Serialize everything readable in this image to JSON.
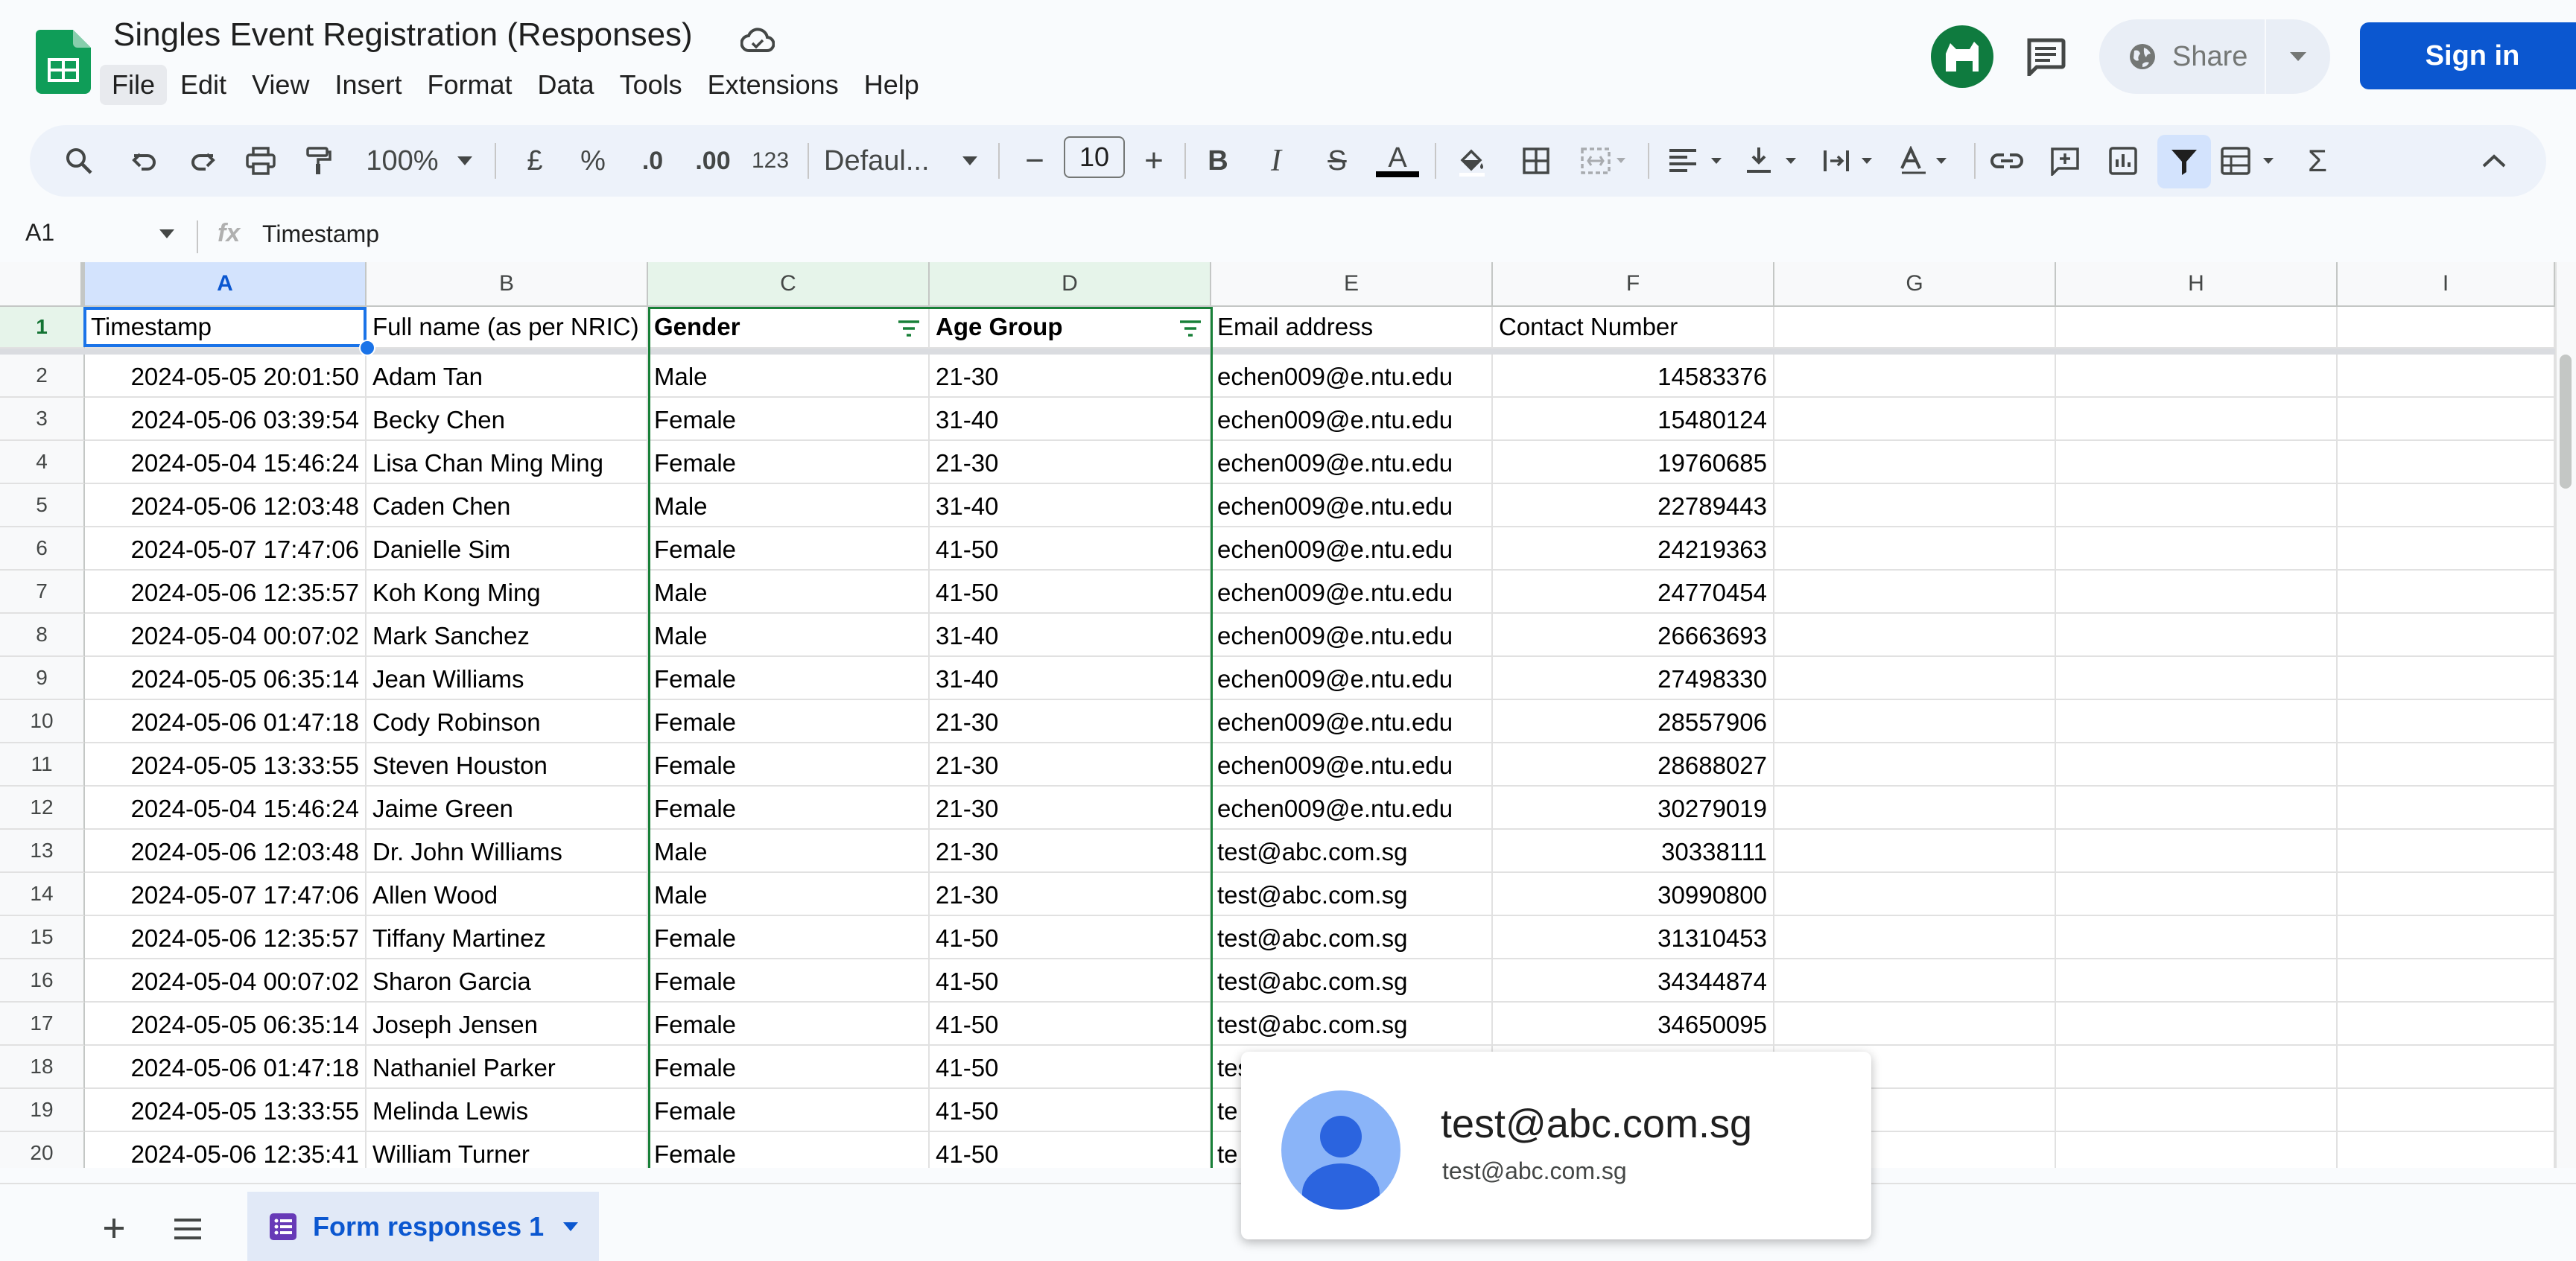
{
  "app": {
    "title": "Singles Event Registration (Responses)",
    "menu": [
      "File",
      "Edit",
      "View",
      "Insert",
      "Format",
      "Data",
      "Tools",
      "Extensions",
      "Help"
    ],
    "share_label": "Share",
    "signin_label": "Sign in"
  },
  "toolbar": {
    "zoom": "100%",
    "currency": "£",
    "percent": "%",
    "decrease_decimal": ".0",
    "increase_decimal": ".00",
    "number_format": "123",
    "font": "Defaul...",
    "font_size": "10",
    "minus": "−",
    "plus": "+",
    "bold": "B",
    "italic": "I",
    "strike": "S",
    "text_color": "A",
    "sum": "Σ"
  },
  "formula_bar": {
    "name_box": "A1",
    "fx": "fx",
    "content": "Timestamp"
  },
  "sheet": {
    "columns": [
      "A",
      "B",
      "C",
      "D",
      "E",
      "F",
      "G",
      "H",
      "I"
    ],
    "headers": [
      "Timestamp",
      "Full name (as per NRIC)",
      "Gender",
      "Age Group",
      "Email address",
      "Contact Number"
    ],
    "rows": [
      [
        "2",
        "2024-05-05 20:01:50",
        "Adam Tan",
        "Male",
        "21-30",
        "echen009@e.ntu.edu",
        "14583376"
      ],
      [
        "3",
        "2024-05-06 03:39:54",
        "Becky Chen",
        "Female",
        "31-40",
        "echen009@e.ntu.edu",
        "15480124"
      ],
      [
        "4",
        "2024-05-04 15:46:24",
        "Lisa Chan Ming Ming",
        "Female",
        "21-30",
        "echen009@e.ntu.edu",
        "19760685"
      ],
      [
        "5",
        "2024-05-06 12:03:48",
        "Caden Chen",
        "Male",
        "31-40",
        "echen009@e.ntu.edu",
        "22789443"
      ],
      [
        "6",
        "2024-05-07 17:47:06",
        "Danielle Sim",
        "Female",
        "41-50",
        "echen009@e.ntu.edu",
        "24219363"
      ],
      [
        "7",
        "2024-05-06 12:35:57",
        "Koh Kong Ming",
        "Male",
        "41-50",
        "echen009@e.ntu.edu",
        "24770454"
      ],
      [
        "8",
        "2024-05-04 00:07:02",
        "Mark Sanchez",
        "Male",
        "31-40",
        "echen009@e.ntu.edu",
        "26663693"
      ],
      [
        "9",
        "2024-05-05 06:35:14",
        "Jean Williams",
        "Female",
        "31-40",
        "echen009@e.ntu.edu",
        "27498330"
      ],
      [
        "10",
        "2024-05-06 01:47:18",
        "Cody Robinson",
        "Female",
        "21-30",
        "echen009@e.ntu.edu",
        "28557906"
      ],
      [
        "11",
        "2024-05-05 13:33:55",
        "Steven Houston",
        "Female",
        "21-30",
        "echen009@e.ntu.edu",
        "28688027"
      ],
      [
        "12",
        "2024-05-04 15:46:24",
        "Jaime Green",
        "Female",
        "21-30",
        "echen009@e.ntu.edu",
        "30279019"
      ],
      [
        "13",
        "2024-05-06 12:03:48",
        "Dr. John Williams",
        "Male",
        "21-30",
        "test@abc.com.sg",
        "30338111"
      ],
      [
        "14",
        "2024-05-07 17:47:06",
        "Allen Wood",
        "Male",
        "21-30",
        "test@abc.com.sg",
        "30990800"
      ],
      [
        "15",
        "2024-05-06 12:35:57",
        "Tiffany Martinez",
        "Female",
        "41-50",
        "test@abc.com.sg",
        "31310453"
      ],
      [
        "16",
        "2024-05-04 00:07:02",
        "Sharon Garcia",
        "Female",
        "41-50",
        "test@abc.com.sg",
        "34344874"
      ],
      [
        "17",
        "2024-05-05 06:35:14",
        "Joseph Jensen",
        "Female",
        "41-50",
        "test@abc.com.sg",
        "34650095"
      ],
      [
        "18",
        "2024-05-06 01:47:18",
        "Nathaniel Parker",
        "Female",
        "41-50",
        "tes",
        ""
      ],
      [
        "19",
        "2024-05-05 13:33:55",
        "Melinda Lewis",
        "Female",
        "41-50",
        "te",
        ""
      ],
      [
        "20",
        "2024-05-06 12:35:41",
        "William Turner",
        "Female",
        "41-50",
        "te",
        ""
      ]
    ],
    "tab_name": "Form responses 1"
  },
  "hover_card": {
    "name": "test@abc.com.sg",
    "email": "test@abc.com.sg"
  },
  "colors": {
    "accent": "#0b57d0",
    "sheets_green": "#0f9d58",
    "filter_green": "#188038",
    "selection_blue": "#1a73e8"
  }
}
